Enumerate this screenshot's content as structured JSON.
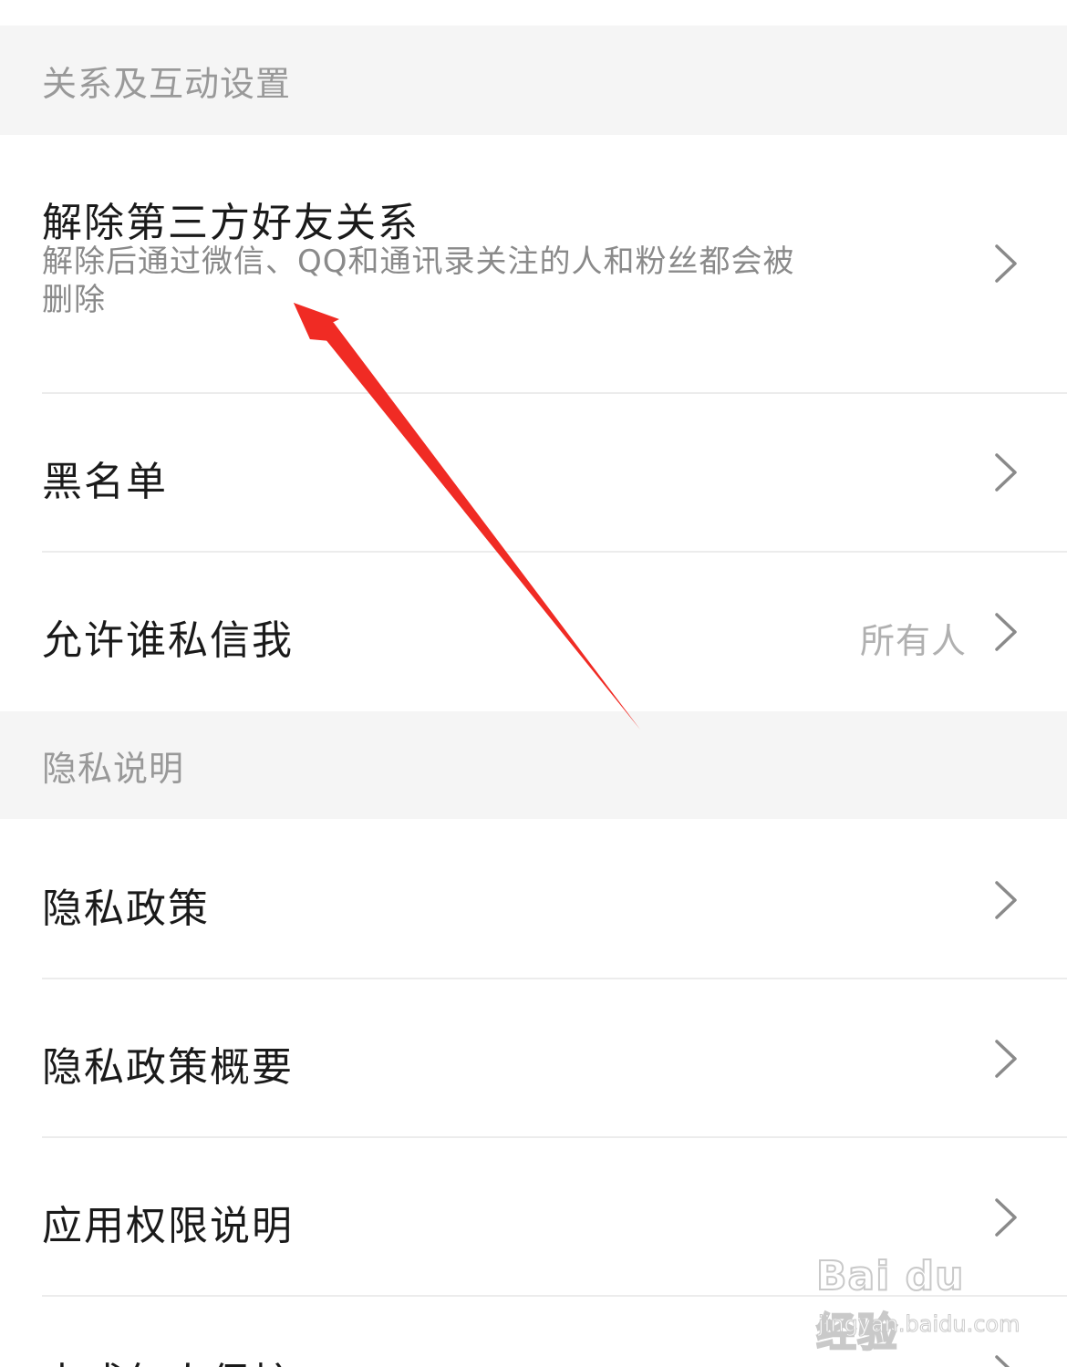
{
  "sections": {
    "relation": {
      "header": "关系及互动设置"
    },
    "privacy": {
      "header": "隐私说明"
    }
  },
  "rows": {
    "unbind": {
      "title": "解除第三方好友关系",
      "desc": "解除后通过微信、QQ和通讯录关注的人和粉丝都会被删除"
    },
    "blacklist": {
      "title": "黑名单"
    },
    "dm": {
      "title": "允许谁私信我",
      "value": "所有人"
    },
    "policy": {
      "title": "隐私政策"
    },
    "policy_summary": {
      "title": "隐私政策概要"
    },
    "permissions": {
      "title": "应用权限说明"
    },
    "minor": {
      "title": "未成年人保护"
    }
  },
  "watermark": {
    "main": "Bai du 经验",
    "sub": "jingyan.baidu.com"
  },
  "icons": {
    "chevron": "chevron-right-icon",
    "annotation": "red-arrow-annotation"
  },
  "colors": {
    "section_bg": "#f5f5f5",
    "title_text": "#1a1a1a",
    "secondary_text": "#8a8a8a",
    "arrow": "#f02b24"
  }
}
